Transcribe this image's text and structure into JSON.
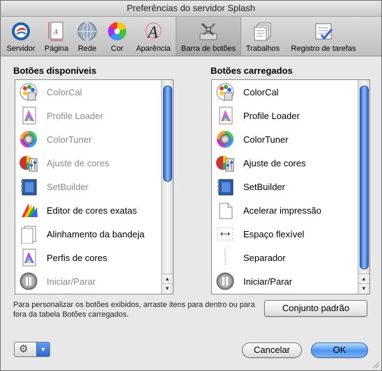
{
  "window": {
    "title": "Preferências do servidor Splash"
  },
  "toolbar": {
    "items": [
      {
        "label": "Servidor",
        "icon": "server-icon"
      },
      {
        "label": "Página",
        "icon": "page-icon"
      },
      {
        "label": "Rede",
        "icon": "network-globe-icon"
      },
      {
        "label": "Cor",
        "icon": "color-wheel-icon"
      },
      {
        "label": "Aparência",
        "icon": "appearance-letter-a-icon"
      },
      {
        "label": "Barra de botões",
        "icon": "toolbar-buttons-icon",
        "selected": true
      },
      {
        "label": "Trabalhos",
        "icon": "jobs-icon"
      },
      {
        "label": "Registro de tarefas",
        "icon": "task-log-icon"
      }
    ]
  },
  "available": {
    "title": "Botões disponíveis",
    "items": [
      {
        "label": "ColorCal",
        "icon": "colorcal-icon",
        "dim": true
      },
      {
        "label": "Profile Loader",
        "icon": "profile-loader-icon",
        "dim": true
      },
      {
        "label": "ColorTuner",
        "icon": "colortuner-icon",
        "dim": true
      },
      {
        "label": "Ajuste de cores",
        "icon": "color-adjust-icon",
        "dim": true
      },
      {
        "label": "SetBuilder",
        "icon": "setbuilder-icon",
        "dim": true
      },
      {
        "label": "Editor de cores exatas",
        "icon": "spot-color-editor-icon",
        "dim": false
      },
      {
        "label": "Alinhamento da bandeja",
        "icon": "tray-alignment-icon",
        "dim": false
      },
      {
        "label": "Perfis de cores",
        "icon": "color-profiles-icon",
        "dim": false
      },
      {
        "label": "Iniciar/Parar",
        "icon": "start-stop-icon",
        "dim": true
      }
    ]
  },
  "loaded": {
    "title": "Botões carregados",
    "items": [
      {
        "label": "ColorCal",
        "icon": "colorcal-icon"
      },
      {
        "label": "Profile Loader",
        "icon": "profile-loader-icon"
      },
      {
        "label": "ColorTuner",
        "icon": "colortuner-icon"
      },
      {
        "label": "Ajuste de cores",
        "icon": "color-adjust-icon"
      },
      {
        "label": "SetBuilder",
        "icon": "setbuilder-icon"
      },
      {
        "label": "Acelerar impressão",
        "icon": "accelerate-print-icon"
      },
      {
        "label": "Espaço flexível",
        "icon": "flexible-space-icon"
      },
      {
        "label": "Separador",
        "icon": "separator-icon"
      },
      {
        "label": "Iniciar/Parar",
        "icon": "start-stop-icon"
      }
    ]
  },
  "help_text": "Para personalizar os botões exibidos, arraste itens para dentro ou para fora da tabela Botões carregados.",
  "buttons": {
    "default_set": "Conjunto padrão",
    "cancel": "Cancelar",
    "ok": "OK"
  },
  "colors": {
    "accent": "#3b7fe6",
    "dim_text": "#888888"
  }
}
